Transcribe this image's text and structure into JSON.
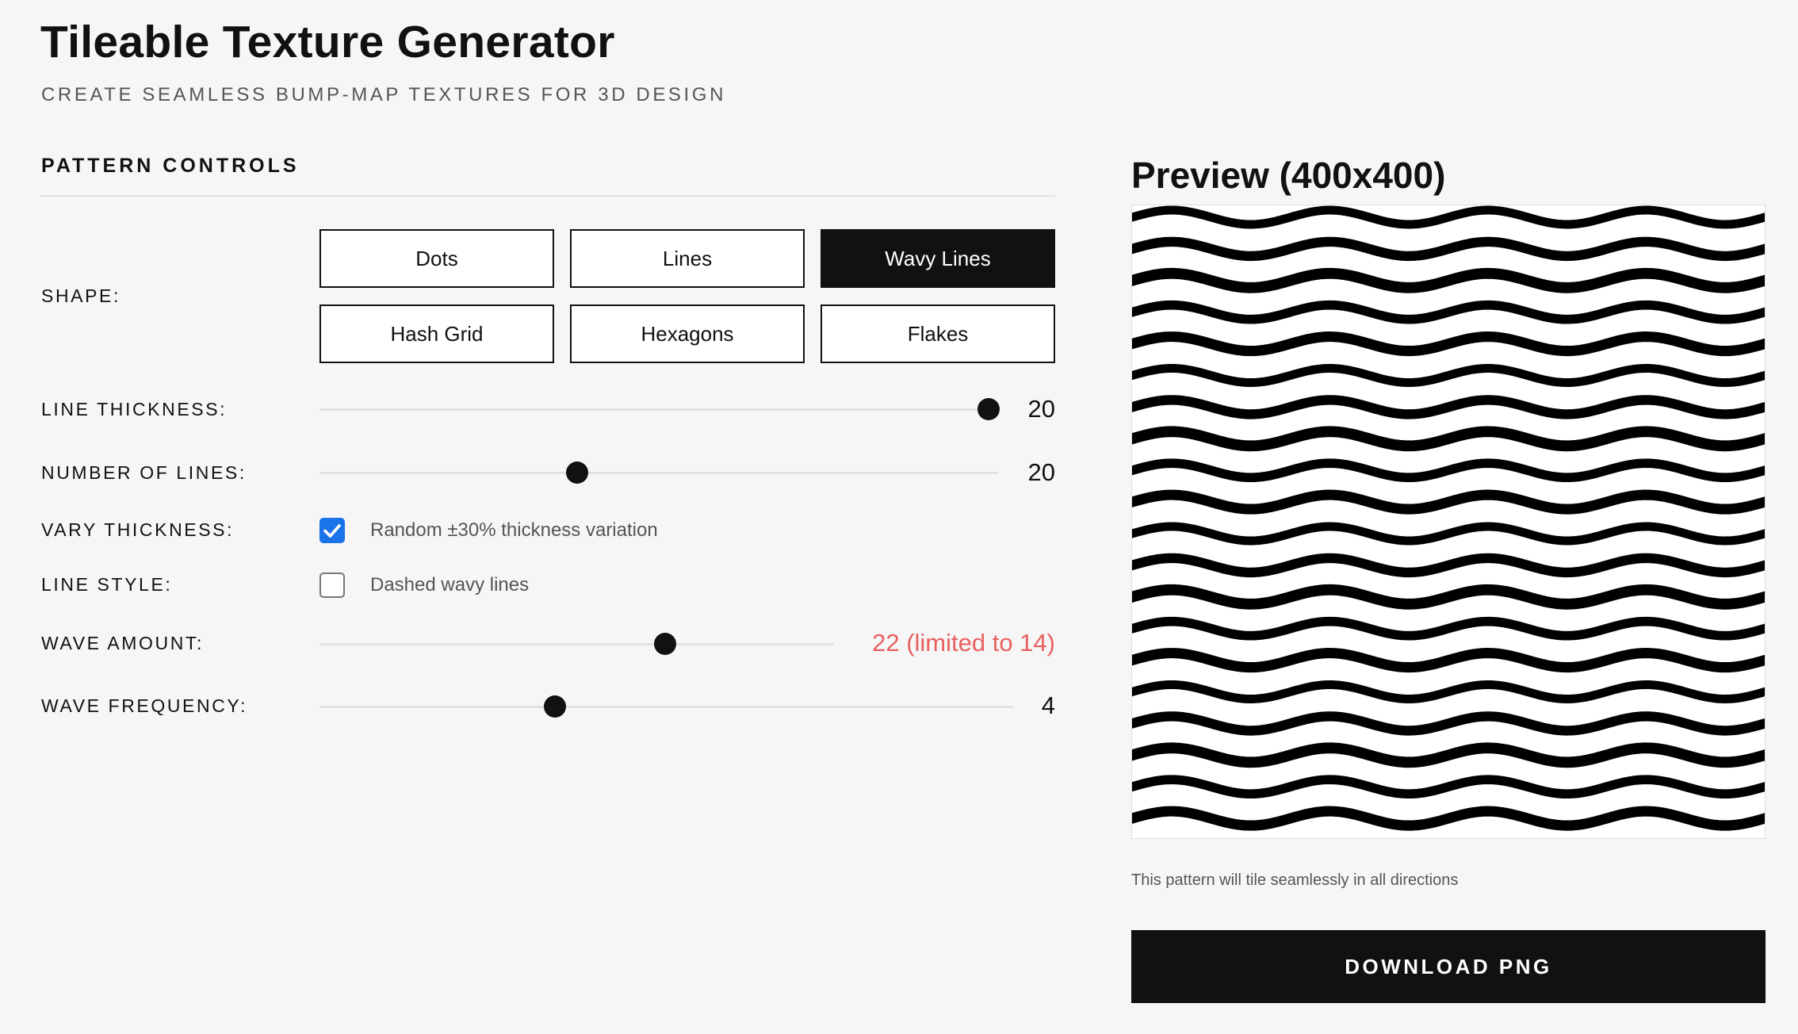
{
  "header": {
    "title": "Tileable Texture Generator",
    "subtitle": "CREATE SEAMLESS BUMP-MAP TEXTURES FOR 3D DESIGN"
  },
  "controls": {
    "section_title": "PATTERN CONTROLS",
    "shape": {
      "label": "SHAPE:",
      "options": [
        "Dots",
        "Lines",
        "Wavy Lines",
        "Hash Grid",
        "Hexagons",
        "Flakes"
      ],
      "selected": "Wavy Lines"
    },
    "line_thickness": {
      "label": "LINE THICKNESS:",
      "value": "20",
      "position": 0.98
    },
    "number_of_lines": {
      "label": "NUMBER OF LINES:",
      "value": "20",
      "position": 0.38
    },
    "vary_thickness": {
      "label": "VARY THICKNESS:",
      "checked": true,
      "text": "Random ±30% thickness variation"
    },
    "line_style": {
      "label": "LINE STYLE:",
      "checked": false,
      "text": "Dashed wavy lines"
    },
    "wave_amount": {
      "label": "WAVE AMOUNT:",
      "value": "22 (limited to 14)",
      "position": 0.67,
      "value_color": "#e86060"
    },
    "wave_frequency": {
      "label": "WAVE FREQUENCY:",
      "value": "4",
      "position": 0.34
    }
  },
  "preview": {
    "title": "Preview (400x400)",
    "note": "This pattern will tile seamlessly in all directions",
    "pattern": {
      "type": "wavy-lines",
      "lines": 20,
      "frequency": 4,
      "amplitude": 14,
      "thickness": 20
    }
  },
  "actions": {
    "download_label": "DOWNLOAD PNG"
  },
  "icons": {
    "checkbox_checked": "checkmark-icon"
  },
  "colors": {
    "accent": "#111111",
    "background": "#f6f6f6",
    "warning": "#e86060",
    "checkbox": "#1a73e8"
  }
}
